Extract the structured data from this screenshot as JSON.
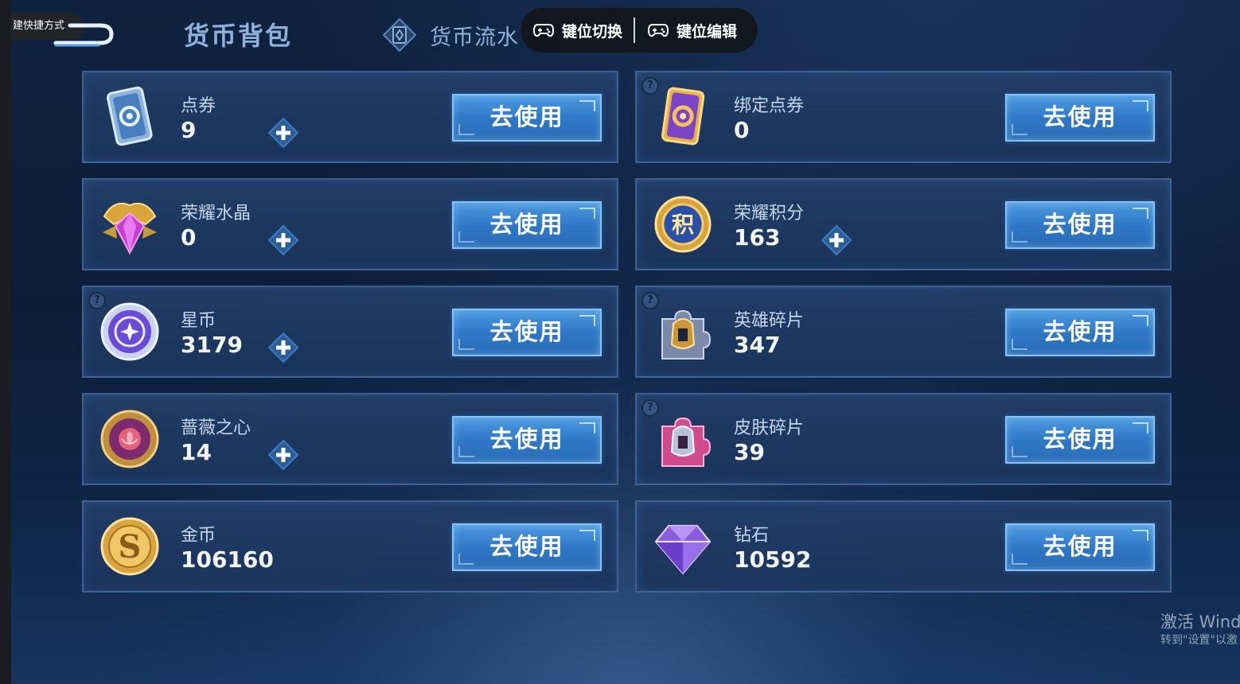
{
  "header": {
    "shortcut_label": "建快捷方式",
    "title": "货币背包",
    "flow_tab": "货币流水",
    "key_switch": "键位切换",
    "key_edit": "键位编辑"
  },
  "cards": [
    {
      "name": "点券",
      "amount": "9",
      "icon": "voucher-card-icon",
      "has_plus": true,
      "has_help": false,
      "button": "去使用"
    },
    {
      "name": "绑定点券",
      "amount": "0",
      "icon": "bound-voucher-card-icon",
      "has_plus": false,
      "has_help": true,
      "button": "去使用"
    },
    {
      "name": "荣耀水晶",
      "amount": "0",
      "icon": "glory-crystal-icon",
      "has_plus": true,
      "has_help": false,
      "button": "去使用"
    },
    {
      "name": "荣耀积分",
      "amount": "163",
      "icon": "glory-points-icon",
      "has_plus": true,
      "has_help": false,
      "button": "去使用"
    },
    {
      "name": "星币",
      "amount": "3179",
      "icon": "star-coin-icon",
      "has_plus": true,
      "has_help": true,
      "button": "去使用"
    },
    {
      "name": "英雄碎片",
      "amount": "347",
      "icon": "hero-fragment-icon",
      "has_plus": false,
      "has_help": true,
      "button": "去使用"
    },
    {
      "name": "蔷薇之心",
      "amount": "14",
      "icon": "rose-heart-icon",
      "has_plus": true,
      "has_help": false,
      "button": "去使用"
    },
    {
      "name": "皮肤碎片",
      "amount": "39",
      "icon": "skin-fragment-icon",
      "has_plus": false,
      "has_help": true,
      "button": "去使用"
    },
    {
      "name": "金币",
      "amount": "106160",
      "icon": "gold-coin-icon",
      "has_plus": false,
      "has_help": false,
      "button": "去使用"
    },
    {
      "name": "钻石",
      "amount": "10592",
      "icon": "diamond-icon",
      "has_plus": false,
      "has_help": false,
      "button": "去使用"
    }
  ],
  "watermark": {
    "line1": "激活 Windo",
    "line2": "转到\"设置\"以激"
  },
  "colors": {
    "accent": "#3a86d6",
    "background": "#0f223f"
  }
}
